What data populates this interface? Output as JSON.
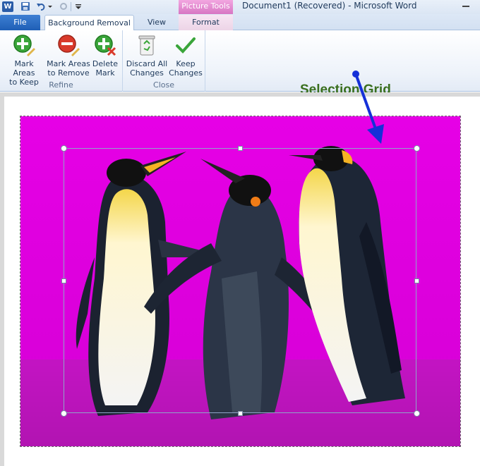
{
  "window": {
    "app_icon_letter": "W",
    "title": "Document1 (Recovered)  -  Microsoft Word",
    "contextual_group": "Picture Tools"
  },
  "tabs": {
    "file": "File",
    "background_removal": "Background Removal",
    "view": "View",
    "format": "Format"
  },
  "ribbon": {
    "refine": {
      "label": "Refine",
      "mark_keep": "Mark Areas\nto Keep",
      "mark_remove": "Mark Areas\nto Remove",
      "delete_mark": "Delete\nMark"
    },
    "close": {
      "label": "Close",
      "discard": "Discard All\nChanges",
      "keep": "Keep\nChanges"
    }
  },
  "annotation": {
    "label": "Selection Grid"
  },
  "colors": {
    "removal_overlay": "#e600e6",
    "keep_green": "#3aa53a",
    "remove_red": "#d93a2b",
    "annotation_green": "#3a6f1e",
    "arrow_blue": "#1530d8"
  }
}
